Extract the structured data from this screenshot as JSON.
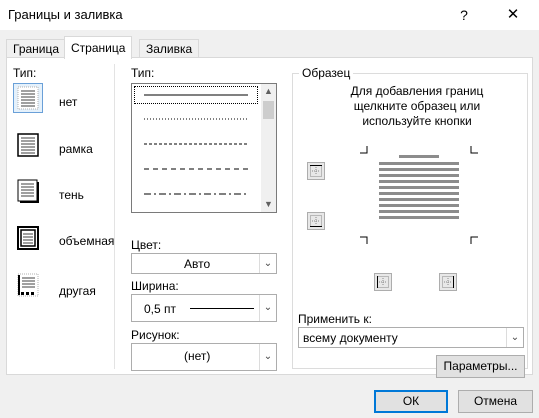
{
  "window": {
    "title": "Границы и заливка",
    "help": "?",
    "close": "✕"
  },
  "tabs": [
    {
      "label": "Граница",
      "active": false
    },
    {
      "label": "Страница",
      "active": true
    },
    {
      "label": "Заливка",
      "active": false
    }
  ],
  "type_section": {
    "label": "Тип:",
    "options": [
      {
        "label": "нет",
        "icon": "page-none-icon",
        "selected": true
      },
      {
        "label": "рамка",
        "icon": "page-box-icon",
        "selected": false
      },
      {
        "label": "тень",
        "icon": "page-shadow-icon",
        "selected": false
      },
      {
        "label": "объемная",
        "icon": "page-3d-icon",
        "selected": false
      },
      {
        "label": "другая",
        "icon": "page-custom-icon",
        "selected": false
      }
    ]
  },
  "style_section": {
    "label": "Тип:",
    "styles": [
      "solid",
      "dotted",
      "dashed-small",
      "dashed",
      "dash-dot"
    ]
  },
  "color": {
    "label": "Цвет:",
    "value": "Авто"
  },
  "width": {
    "label": "Ширина:",
    "value": "0,5 пт"
  },
  "art": {
    "label": "Рисунок:",
    "value": "(нет)"
  },
  "preview": {
    "title": "Образец",
    "hint": "Для добавления границ щелкните образец или используйте кнопки"
  },
  "apply_to": {
    "label": "Применить к:",
    "value": "всему документу"
  },
  "buttons": {
    "options": "Параметры...",
    "ok": "ОК",
    "cancel": "Отмена"
  }
}
